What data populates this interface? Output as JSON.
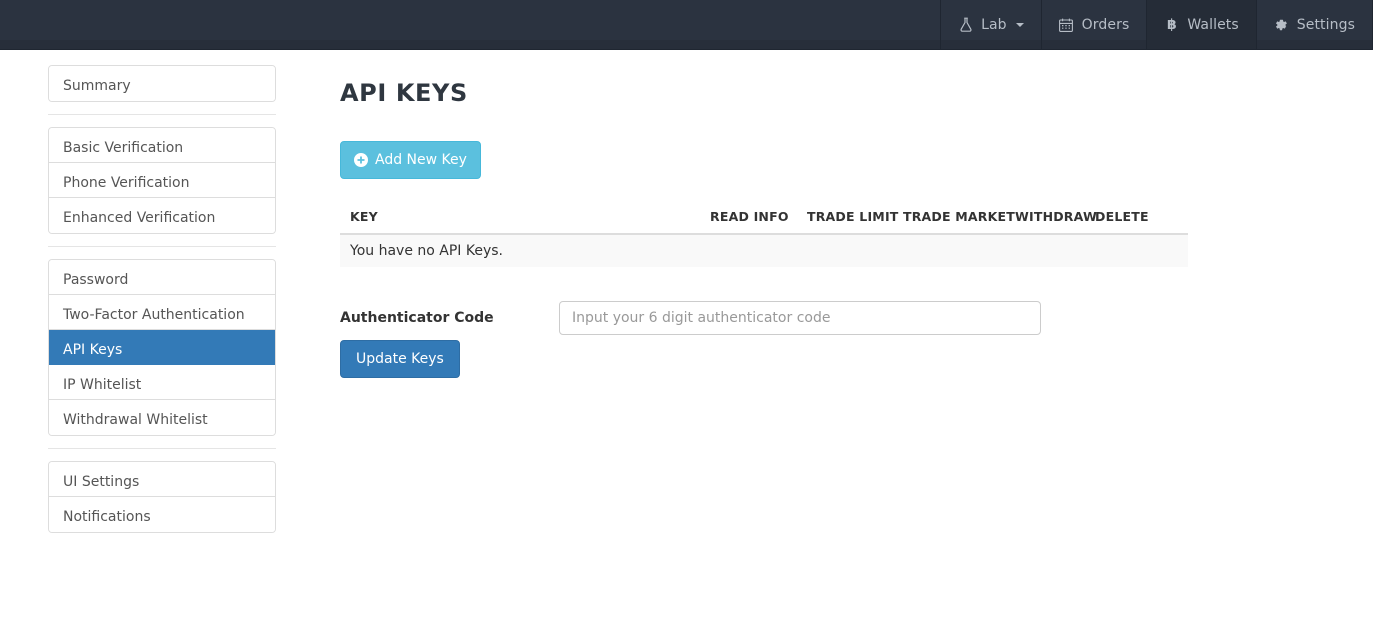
{
  "navbar": {
    "items": [
      {
        "label": "Lab",
        "icon": "flask-icon",
        "has_caret": true,
        "active": false
      },
      {
        "label": "Orders",
        "icon": "calendar-icon",
        "has_caret": false,
        "active": false
      },
      {
        "label": "Wallets",
        "icon": "bitcoin-icon",
        "has_caret": false,
        "active": true
      },
      {
        "label": "Settings",
        "icon": "gear-icon",
        "has_caret": false,
        "active": false
      }
    ],
    "background_color": "#2b3340",
    "text_color": "#b6bdc6"
  },
  "sidebar": {
    "groups": [
      {
        "items": [
          {
            "label": "Summary",
            "active": false
          }
        ]
      },
      {
        "items": [
          {
            "label": "Basic Verification",
            "active": false
          },
          {
            "label": "Phone Verification",
            "active": false
          },
          {
            "label": "Enhanced Verification",
            "active": false
          }
        ]
      },
      {
        "items": [
          {
            "label": "Password",
            "active": false
          },
          {
            "label": "Two-Factor Authentication",
            "active": false
          },
          {
            "label": "API Keys",
            "active": true
          },
          {
            "label": "IP Whitelist",
            "active": false
          },
          {
            "label": "Withdrawal Whitelist",
            "active": false
          }
        ]
      },
      {
        "items": [
          {
            "label": "UI Settings",
            "active": false
          },
          {
            "label": "Notifications",
            "active": false
          }
        ]
      }
    ],
    "active_color": "#337ab7"
  },
  "main": {
    "title": "API KEYS",
    "add_key_button": "Add New Key",
    "add_key_color": "#5bc0de",
    "table": {
      "headers": [
        "KEY",
        "READ INFO",
        "TRADE LIMIT",
        "TRADE MARKET",
        "WITHDRAW",
        "DELETE"
      ],
      "empty_message": "You have no API Keys.",
      "rows": []
    },
    "form": {
      "authenticator_label": "Authenticator Code",
      "authenticator_value": "",
      "authenticator_placeholder": "Input your 6 digit authenticator code",
      "submit_label": "Update Keys",
      "submit_color": "#337ab7"
    }
  }
}
